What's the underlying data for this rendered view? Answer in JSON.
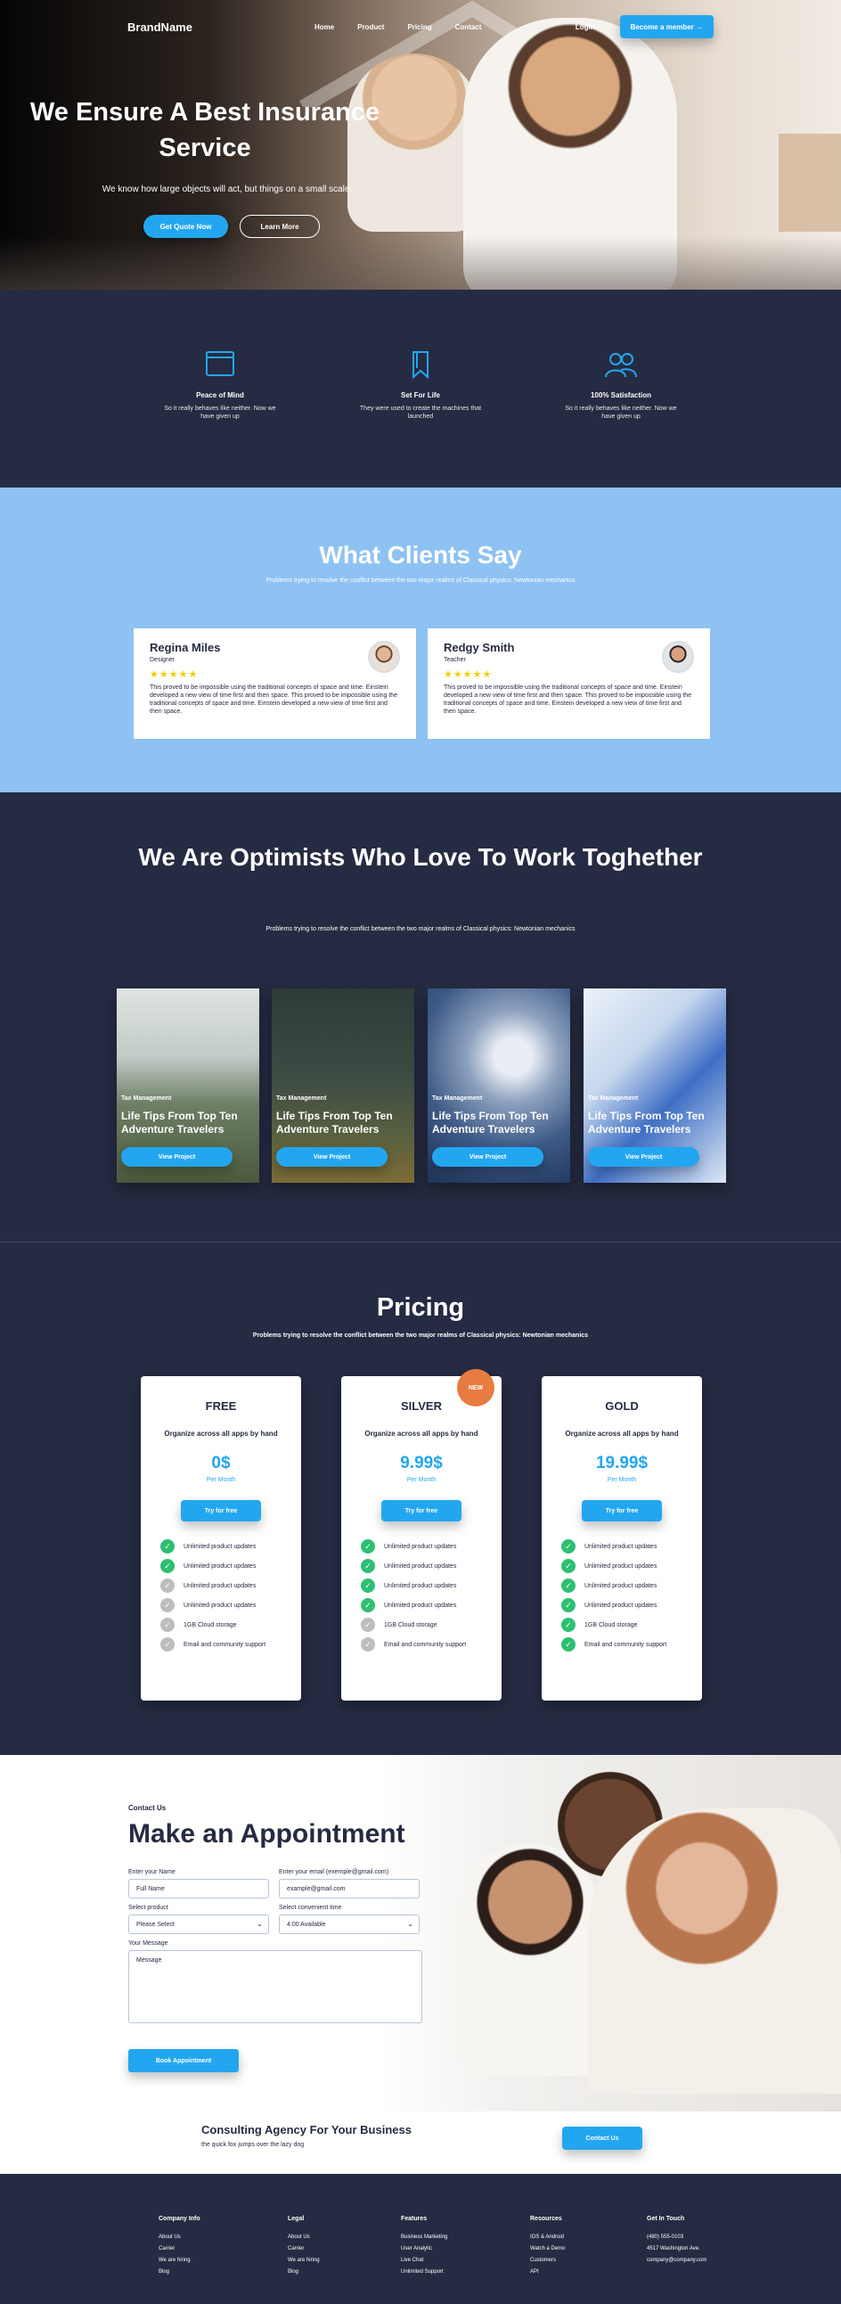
{
  "nav": {
    "brand": "BrandName",
    "menu": [
      "Home",
      "Product",
      "Pricing",
      "Contact"
    ],
    "login": "Login",
    "member": "Become a member →"
  },
  "hero": {
    "title": "We Ensure A Best Insurance Service",
    "subtitle": "We know how large objects will act, but things on a small scale.",
    "primary": "Get Quote Now",
    "secondary": "Learn More"
  },
  "features": [
    {
      "icon": "card-icon",
      "title": "Peace of Mind",
      "text": "So it really behaves like neither. Now we have given up"
    },
    {
      "icon": "bookmark-icon",
      "title": "Set For Life",
      "text": "They were used to create the machines that launched"
    },
    {
      "icon": "users-icon",
      "title": "100% Satisfaction",
      "text": "So it really behaves like neither. Now we have given up"
    }
  ],
  "clients": {
    "title": "What Clients Say",
    "subtitle": "Problems trying to resolve the conflict between the two major realms of Classical physics: Newtonian mechanics",
    "items": [
      {
        "name": "Regina Miles",
        "role": "Designer",
        "stars": "★★★★★",
        "text": "This proved to be impossible using the traditional concepts of space and time. Einstein developed a new view of time first and then space. This proved to be impossible using the traditional concepts of space and time. Einstein developed a new view of time first and then space."
      },
      {
        "name": "Redgy Smith",
        "role": "Teacher",
        "stars": "★★★★★",
        "text": "This proved to be impossible using the traditional concepts of space and time. Einstein developed a new view of time first and then space. This proved to be impossible using the traditional concepts of space and time. Einstein developed a new view of time first and then space."
      }
    ]
  },
  "projects": {
    "title": "We Are Optimists Who Love To Work Toghether",
    "subtitle": "Problems trying to resolve the conflict between the two major realms of Classical physics: Newtonian mechanics",
    "cards": [
      {
        "tag": "Tax Management",
        "title": "Life Tips From Top Ten Adventure Travelers",
        "button": "View Project"
      },
      {
        "tag": "Tax Management",
        "title": "Life Tips From Top Ten Adventure Travelers",
        "button": "View Project"
      },
      {
        "tag": "Tax Management",
        "title": "Life Tips From Top Ten Adventure Travelers",
        "button": "View Project"
      },
      {
        "tag": "Tax Management",
        "title": "Life Tips From Top Ten Adventure Travelers",
        "button": "View Project"
      }
    ]
  },
  "pricing": {
    "title": "Pricing",
    "subtitle": "Problems trying to resolve the conflict between the two major realms of Classical physics: Newtonian mechanics",
    "features": [
      "Unlimited product updates",
      "Unlimited product updates",
      "Unlimited product updates",
      "Unlimited product updates",
      "1GB Cloud storage",
      "Email and community support"
    ],
    "plans": [
      {
        "name": "FREE",
        "desc": "Organize across all apps by hand",
        "price": "0$",
        "per": "Per Month",
        "button": "Try for free",
        "checks": [
          true,
          true,
          false,
          false,
          false,
          false
        ]
      },
      {
        "name": "SILVER",
        "badge": "NEW",
        "desc": "Organize across all apps by hand",
        "price": "9.99$",
        "per": "Per Month",
        "button": "Try for free",
        "checks": [
          true,
          true,
          true,
          true,
          false,
          false
        ]
      },
      {
        "name": "GOLD",
        "desc": "Organize across all apps by hand",
        "price": "19.99$",
        "per": "Per Month",
        "button": "Try for free",
        "checks": [
          true,
          true,
          true,
          true,
          true,
          true
        ]
      }
    ]
  },
  "appointment": {
    "eyebrow": "Contact Us",
    "title": "Make an Appointment",
    "name_label": "Enter your Name",
    "name_value": "Full Name",
    "email_label": "Enter your email (exemple@gmail.com)",
    "email_value": "example@gmail.com",
    "product_label": "Select product",
    "product_value": "Please Select",
    "time_label": "Select convenient time",
    "time_value": "4:00 Available",
    "msg_label": "Your Message",
    "msg_value": "Message",
    "button": "Book Appointment"
  },
  "cta": {
    "title": "Consulting Agency For Your Business",
    "text": "the quick fox jumps over the lazy dog",
    "button": "Contact Us"
  },
  "footer": [
    {
      "title": "Company Info",
      "links": [
        "About Us",
        "Carrier",
        "We are hiring",
        "Blog"
      ]
    },
    {
      "title": "Legal",
      "links": [
        "About Us",
        "Carrier",
        "We are hiring",
        "Blog"
      ]
    },
    {
      "title": "Features",
      "links": [
        "Business Marketing",
        "User Analytic",
        "Live Chat",
        "Unlimited Support"
      ]
    },
    {
      "title": "Resources",
      "links": [
        "IOS & Android",
        "Watch a Demo",
        "Customers",
        "API"
      ]
    },
    {
      "title": "Get In Touch",
      "links": [
        "(480) 555-0103",
        "4517 Washington Ave.",
        "company@company.com"
      ]
    }
  ],
  "colors": {
    "primary": "#23a6f0",
    "dark": "#252b42",
    "light_blue": "#8ec2f2",
    "success": "#2dc071",
    "badge": "#e77c40",
    "star": "#f3cd03"
  }
}
